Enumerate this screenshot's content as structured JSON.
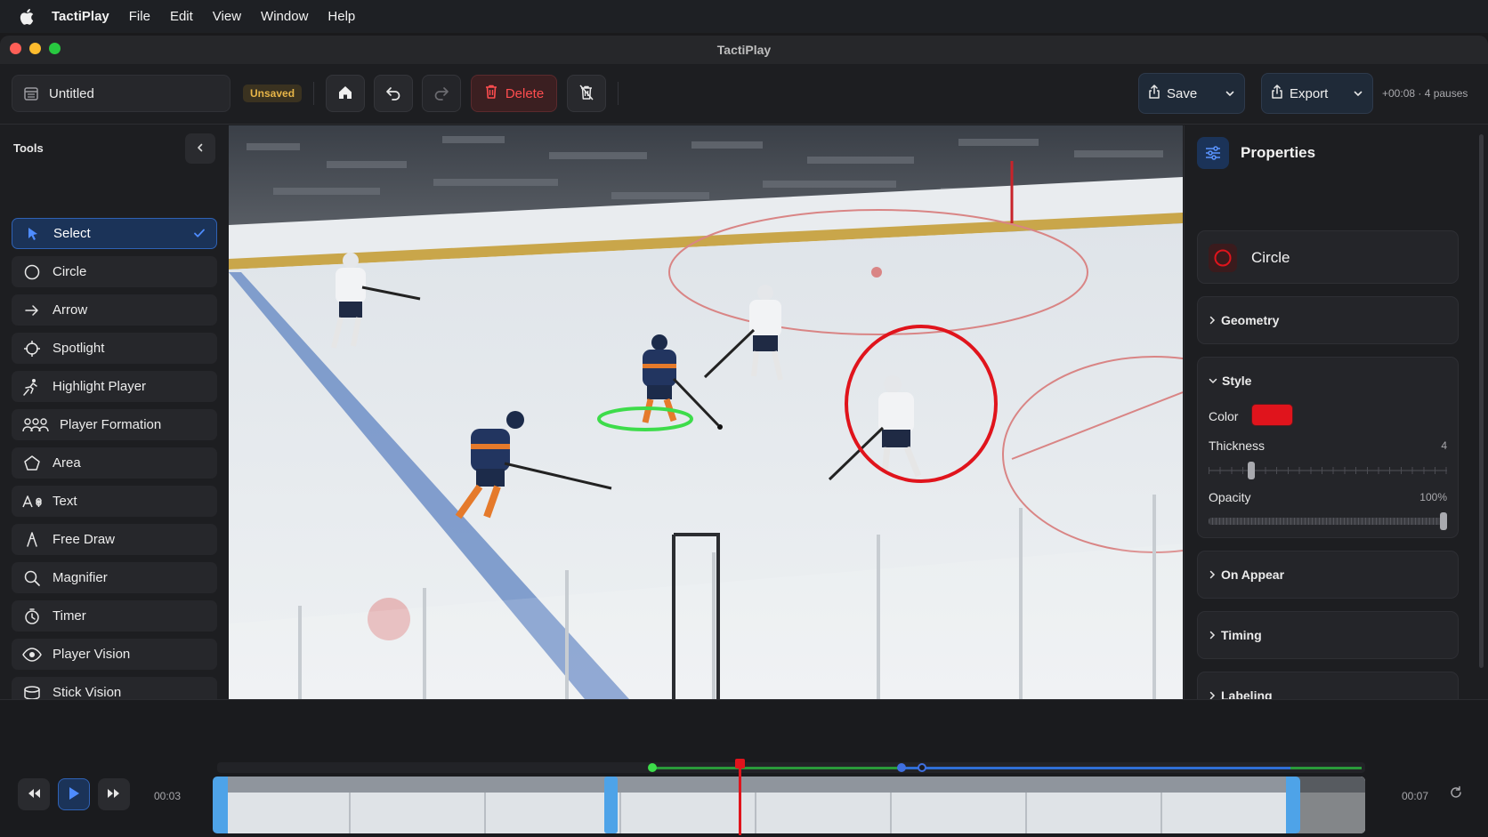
{
  "menubar": {
    "app_name": "TactiPlay",
    "items": [
      "File",
      "Edit",
      "View",
      "Window",
      "Help"
    ]
  },
  "window": {
    "title": "TactiPlay"
  },
  "toolbar": {
    "document_name": "Untitled",
    "status_badge": "Unsaved",
    "delete_label": "Delete",
    "save_label": "Save",
    "export_label": "Export",
    "duration_info": "+00:08 · 4 pauses"
  },
  "sidebar": {
    "title": "Tools",
    "tools": [
      {
        "label": "Select",
        "icon": "cursor-icon",
        "active": true
      },
      {
        "label": "Circle",
        "icon": "circle-icon"
      },
      {
        "label": "Arrow",
        "icon": "arrow-right-icon"
      },
      {
        "label": "Spotlight",
        "icon": "spotlight-icon"
      },
      {
        "label": "Highlight Player",
        "icon": "skater-icon"
      },
      {
        "label": "Player Formation",
        "icon": "group-icon"
      },
      {
        "label": "Area",
        "icon": "pentagon-icon"
      },
      {
        "label": "Text",
        "icon": "text-icon"
      },
      {
        "label": "Free Draw",
        "icon": "pen-icon"
      },
      {
        "label": "Magnifier",
        "icon": "magnifier-icon"
      },
      {
        "label": "Timer",
        "icon": "timer-icon"
      },
      {
        "label": "Player Vision",
        "icon": "eye-icon"
      },
      {
        "label": "Stick Vision",
        "icon": "cylinder-icon"
      }
    ]
  },
  "properties": {
    "title": "Properties",
    "selected_shape": "Circle",
    "sections": {
      "geometry": "Geometry",
      "style": "Style",
      "on_appear": "On Appear",
      "timing": "Timing",
      "labeling": "Labeling"
    },
    "style": {
      "color_label": "Color",
      "color": "#e0141c",
      "thickness_label": "Thickness",
      "thickness_value": "4",
      "thickness_fraction": 0.17,
      "opacity_label": "Opacity",
      "opacity_value": "100%",
      "opacity_fraction": 1.0
    }
  },
  "timeline": {
    "current_time": "00:03",
    "end_time": "00:07",
    "playhead_fraction": 0.455
  },
  "colors": {
    "accent": "#2f6fd6",
    "danger": "#ff4d4f",
    "highlight_green": "#3ddc4a",
    "annotation_red": "#e0141c"
  }
}
